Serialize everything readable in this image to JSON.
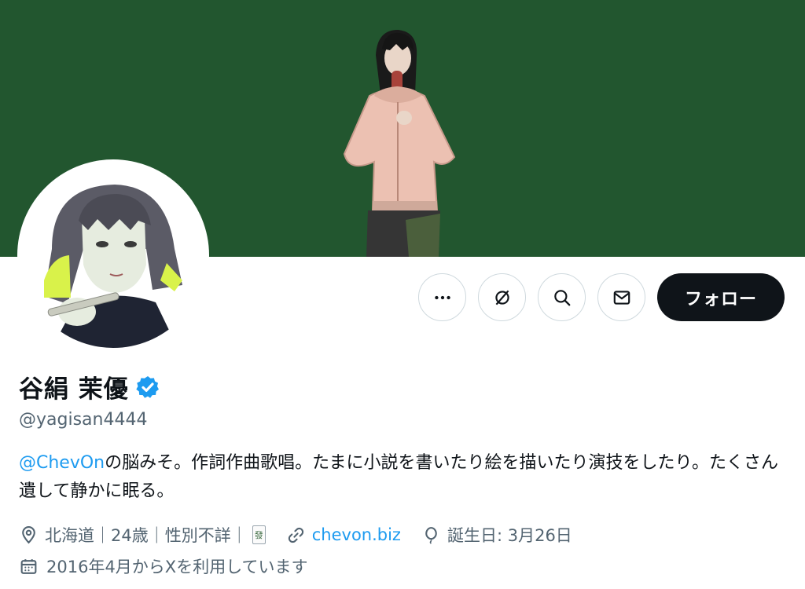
{
  "profile": {
    "display_name": "谷絹 茉優",
    "handle": "@yagisan4444",
    "bio_mention": "@ChevOn",
    "bio_text": "の脳みそ。作詞作曲歌唱。たまに小説を書いたり絵を描いたり演技をしたり。たくさん遺して静かに眠る。",
    "location": "北海道｜24歳｜性別不詳｜",
    "mahjong_tile": "發",
    "website": "chevon.biz",
    "birthday": "誕生日: 3月26日",
    "joined": "2016年4月からXを利用しています"
  },
  "actions": {
    "follow_label": "フォロー"
  },
  "icons": {
    "more": "more-icon",
    "grok": "grok-icon",
    "search": "search-icon",
    "message": "mail-icon",
    "verified": "verified-badge-icon",
    "location": "location-pin-icon",
    "link": "link-icon",
    "birthday": "balloon-icon",
    "joined": "calendar-icon"
  },
  "colors": {
    "banner": "#22562f",
    "accent": "#1d9bf0",
    "follow_bg": "#0f1419"
  }
}
